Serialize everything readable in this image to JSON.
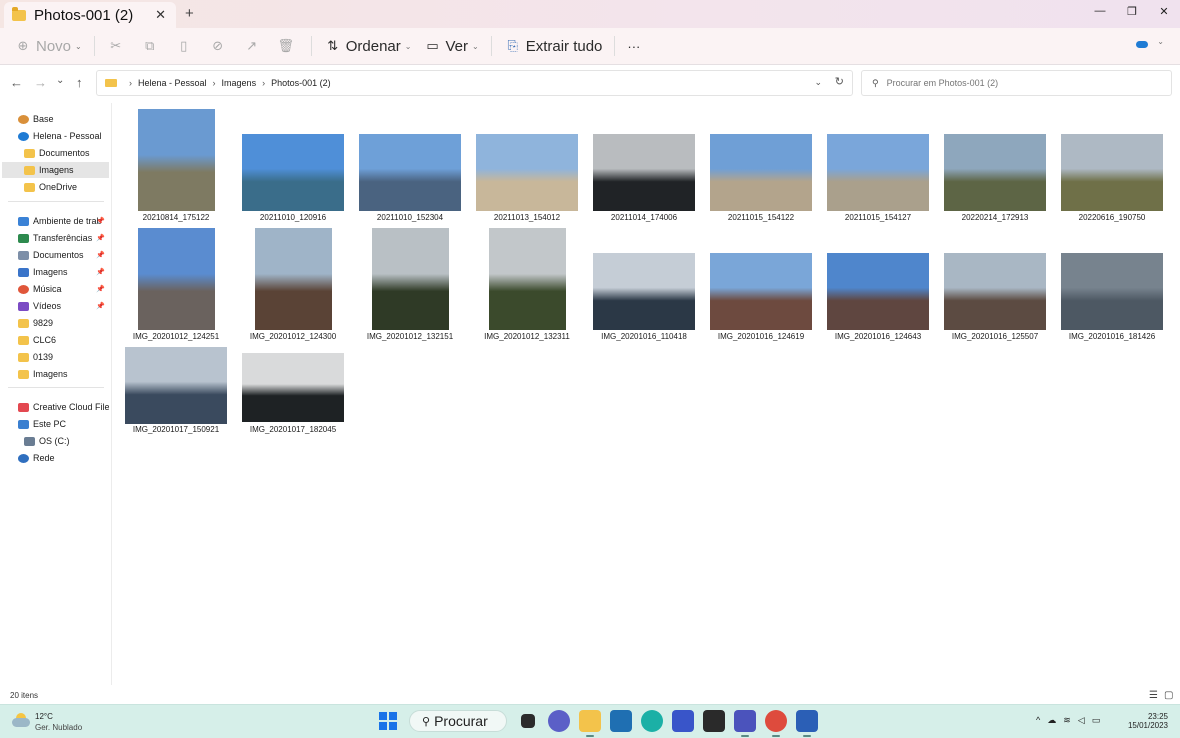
{
  "window": {
    "tab_title": "Photos-001 (2)",
    "tab_close": "✕",
    "new_tab": "+",
    "minimize": "—",
    "maximize": "❐",
    "close": "✕"
  },
  "toolbar": {
    "new_label": "Novo",
    "sort_label": "Ordenar",
    "view_label": "Ver",
    "extract_label": "Extrair tudo",
    "more_label": "···"
  },
  "nav": {
    "back": "←",
    "forward": "→",
    "recent": "⌄",
    "up": "↑"
  },
  "address": {
    "crumbs": [
      "Helena - Pessoal",
      "Imagens",
      "Photos-001 (2)"
    ],
    "search_placeholder": "Procurar em Photos-001 (2)"
  },
  "sidebar": {
    "items": [
      {
        "label": "Base",
        "icon": "home-icon"
      },
      {
        "label": "Helena - Pessoal",
        "icon": "onedrive-icon"
      },
      {
        "label": "Documentos",
        "icon": "folder-icon"
      },
      {
        "label": "Imagens",
        "icon": "folder-icon"
      },
      {
        "label": "OneDrive",
        "icon": "folder-icon"
      },
      {
        "label": "Ambiente de trab",
        "icon": "desktop-icon"
      },
      {
        "label": "Transferências",
        "icon": "download-icon"
      },
      {
        "label": "Documentos",
        "icon": "documents-icon"
      },
      {
        "label": "Imagens",
        "icon": "pictures-icon"
      },
      {
        "label": "Música",
        "icon": "music-icon"
      },
      {
        "label": "Vídeos",
        "icon": "videos-icon"
      },
      {
        "label": "9829",
        "icon": "folder-icon"
      },
      {
        "label": "CLC6",
        "icon": "folder-icon"
      },
      {
        "label": "0139",
        "icon": "folder-icon"
      },
      {
        "label": "Imagens",
        "icon": "folder-icon"
      },
      {
        "label": "Creative Cloud Files",
        "icon": "creative-cloud-icon"
      },
      {
        "label": "Este PC",
        "icon": "pc-icon"
      },
      {
        "label": "OS (C:)",
        "icon": "drive-icon"
      },
      {
        "label": "Rede",
        "icon": "network-icon"
      }
    ]
  },
  "files": [
    {
      "name": "20210814_175122",
      "colors": [
        "#6a9ad1",
        "#7e7a62"
      ]
    },
    {
      "name": "20211010_120916",
      "colors": [
        "#4f8fd8",
        "#3a6d8a"
      ]
    },
    {
      "name": "20211010_152304",
      "colors": [
        "#6ea0d8",
        "#4a6380"
      ]
    },
    {
      "name": "20211013_154012",
      "colors": [
        "#8fb4dc",
        "#c8b79a"
      ]
    },
    {
      "name": "20211014_174006",
      "colors": [
        "#b9bcbf",
        "#202326"
      ]
    },
    {
      "name": "20211015_154122",
      "colors": [
        "#6f9fd6",
        "#b3a48c"
      ]
    },
    {
      "name": "20211015_154127",
      "colors": [
        "#7aa6da",
        "#aaa08c"
      ]
    },
    {
      "name": "20220214_172913",
      "colors": [
        "#8ea7bd",
        "#5d6545"
      ]
    },
    {
      "name": "20220616_190750",
      "colors": [
        "#aeb9c4",
        "#6f7048"
      ]
    },
    {
      "name": "IMG_20201012_124251",
      "colors": [
        "#5a8cd0",
        "#6a625e"
      ]
    },
    {
      "name": "IMG_20201012_124300",
      "colors": [
        "#9fb4c8",
        "#5a4336"
      ]
    },
    {
      "name": "IMG_20201012_132151",
      "colors": [
        "#b9c0c5",
        "#2f3a26"
      ]
    },
    {
      "name": "IMG_20201012_132311",
      "colors": [
        "#c2c7ca",
        "#3b4a2c"
      ]
    },
    {
      "name": "IMG_20201016_110418",
      "colors": [
        "#c5cdd6",
        "#2b3846"
      ]
    },
    {
      "name": "IMG_20201016_124619",
      "colors": [
        "#7aa6d8",
        "#6d4a3f"
      ]
    },
    {
      "name": "IMG_20201016_124643",
      "colors": [
        "#4f86cc",
        "#5f4640"
      ]
    },
    {
      "name": "IMG_20201016_125507",
      "colors": [
        "#a9b7c4",
        "#5c4b42"
      ]
    },
    {
      "name": "IMG_20201016_181426",
      "colors": [
        "#77838e",
        "#4d5863"
      ]
    },
    {
      "name": "IMG_20201017_150921",
      "colors": [
        "#b8c3cf",
        "#3a4a5e"
      ]
    },
    {
      "name": "IMG_20201017_182045",
      "colors": [
        "#d9dadb",
        "#1e2224"
      ]
    }
  ],
  "status": {
    "count": "20 itens"
  },
  "taskbar": {
    "temperature": "12°C",
    "weather": "Ger. Nublado",
    "search_label": "Procurar",
    "time": "23:25",
    "date": "15/01/2023"
  }
}
